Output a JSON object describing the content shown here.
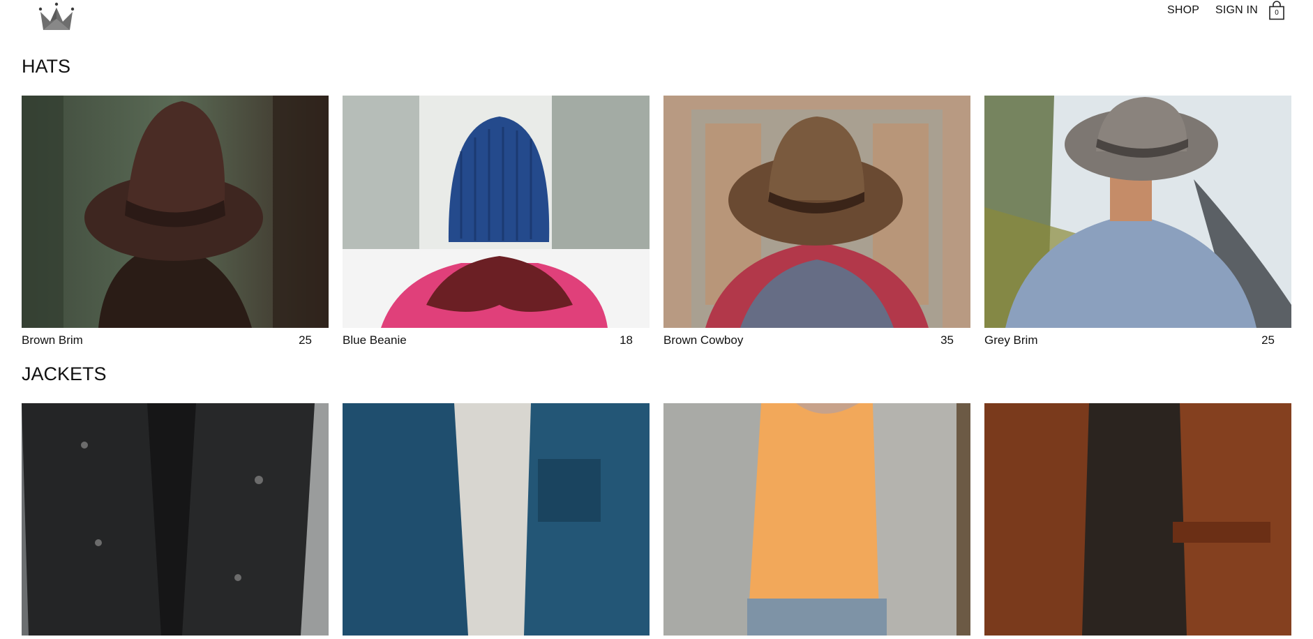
{
  "header": {
    "logo_icon": "crown-icon",
    "nav": {
      "shop_label": "SHOP",
      "signin_label": "SIGN IN",
      "cart_icon": "shopping-bag-icon",
      "cart_count": "0"
    }
  },
  "sections": [
    {
      "title": "HATS",
      "items": [
        {
          "name": "Brown Brim",
          "price": "25"
        },
        {
          "name": "Blue Beanie",
          "price": "18"
        },
        {
          "name": "Brown Cowboy",
          "price": "35"
        },
        {
          "name": "Grey Brim",
          "price": "25"
        }
      ]
    },
    {
      "title": "JACKETS",
      "items": [
        {
          "name": "",
          "price": ""
        },
        {
          "name": "",
          "price": ""
        },
        {
          "name": "",
          "price": ""
        },
        {
          "name": "",
          "price": ""
        }
      ]
    }
  ],
  "colors": {
    "text": "#111111",
    "background": "#ffffff",
    "logo_grey": "#6b6b6b"
  }
}
